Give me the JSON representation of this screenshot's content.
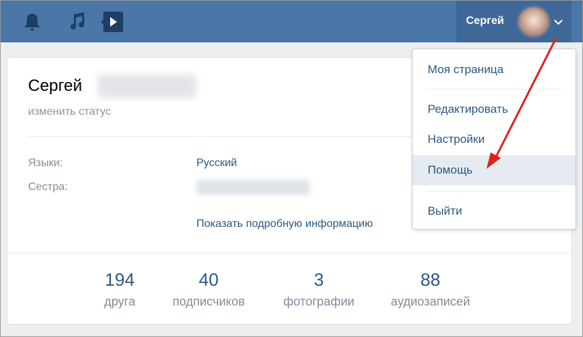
{
  "header": {
    "bell_icon": "bell-icon",
    "music_icon": "music-icon",
    "video_icon": "video-icon",
    "profile_name": "Сергей",
    "colors": {
      "bar": "#4a76a8",
      "active": "#3d6898"
    }
  },
  "profile": {
    "first_name": "Сергей",
    "status_link": "изменить статус",
    "info": [
      {
        "label": "Языки:",
        "value": "Русский"
      },
      {
        "label": "Сестра:",
        "value": ""
      }
    ],
    "more_info_link": "Показать подробную информацию",
    "counters": [
      {
        "value": "194",
        "caption": "друга"
      },
      {
        "value": "40",
        "caption": "подписчиков"
      },
      {
        "value": "3",
        "caption": "фотографии"
      },
      {
        "value": "88",
        "caption": "аудиозаписей"
      }
    ]
  },
  "menu": {
    "items": [
      {
        "label": "Моя страница"
      },
      {
        "label": "Редактировать"
      },
      {
        "label": "Настройки"
      },
      {
        "label": "Помощь",
        "active": true
      },
      {
        "label": "Выйти"
      }
    ]
  },
  "annotation": {
    "arrow_color": "#e0201b"
  }
}
